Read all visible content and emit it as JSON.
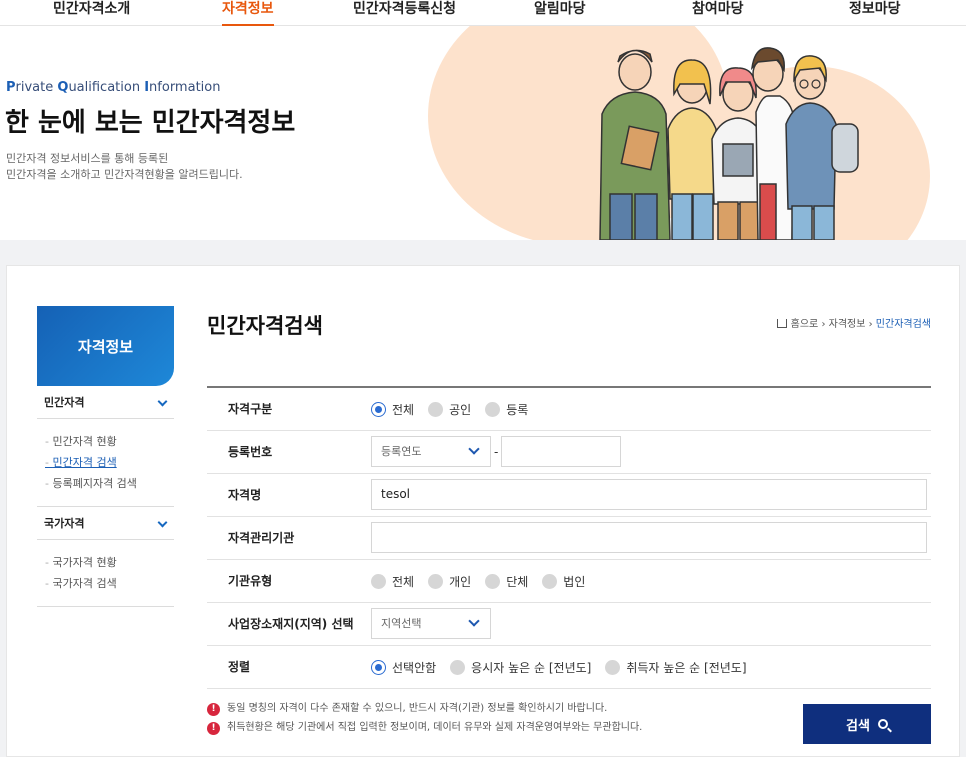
{
  "nav": {
    "items": [
      "민간자격소개",
      "자격정보",
      "민간자격등록신청",
      "알림마당",
      "참여마당",
      "정보마당"
    ],
    "active_index": 1
  },
  "hero": {
    "eng_parts": [
      "P",
      "rivate ",
      "Q",
      "ualification ",
      "I",
      "nformation"
    ],
    "title": "한 눈에 보는 민간자격정보",
    "desc_line1": "민간자격 정보서비스를 통해 등록된",
    "desc_line2": "민간자격을 소개하고 민간자격현황을 알려드립니다."
  },
  "sidebar": {
    "head": "자격정보",
    "groups": [
      {
        "label": "민간자격",
        "items": [
          "민간자격 현황",
          "민간자격 검색",
          "등록폐지자격 검색"
        ],
        "active_item": 1
      },
      {
        "label": "국가자격",
        "items": [
          "국가자격 현황",
          "국가자격 검색"
        ]
      }
    ]
  },
  "page": {
    "title": "민간자격검색",
    "breadcrumb": [
      "홈으로",
      "자격정보",
      "민간자격검색"
    ]
  },
  "form": {
    "qual_type": {
      "label": "자격구분",
      "options": [
        "전체",
        "공인",
        "등록"
      ],
      "selected": 0
    },
    "reg_no": {
      "label": "등록번호",
      "year_select": "등록연도",
      "dash": "-",
      "number_value": ""
    },
    "qual_name": {
      "label": "자격명",
      "value": "tesol"
    },
    "org": {
      "label": "자격관리기관",
      "value": ""
    },
    "org_type": {
      "label": "기관유형",
      "options": [
        "전체",
        "개인",
        "단체",
        "법인"
      ],
      "selected": null
    },
    "region": {
      "label": "사업장소재지(지역) 선택",
      "select": "지역선택"
    },
    "sort": {
      "label": "정렬",
      "options": [
        "선택안함",
        "응시자 높은 순 [전년도]",
        "취득자 높은 순 [전년도]"
      ],
      "selected": 0
    }
  },
  "notes": [
    "동일 명칭의 자격이 다수 존재할 수 있으니, 반드시 자격(기관) 정보를 확인하시기 바랍니다.",
    "취득현황은 해당 기관에서 직접 입력한 정보이며, 데이터 유무와 실제 자격운영여부와는 무관합니다."
  ],
  "search_button": "검색",
  "colors": {
    "accent_nav": "#e8570d",
    "primary": "#0f2f7e",
    "radio": "#2a6bd1",
    "hero_blob": "#fde2cc",
    "notice": "#d7263d"
  }
}
